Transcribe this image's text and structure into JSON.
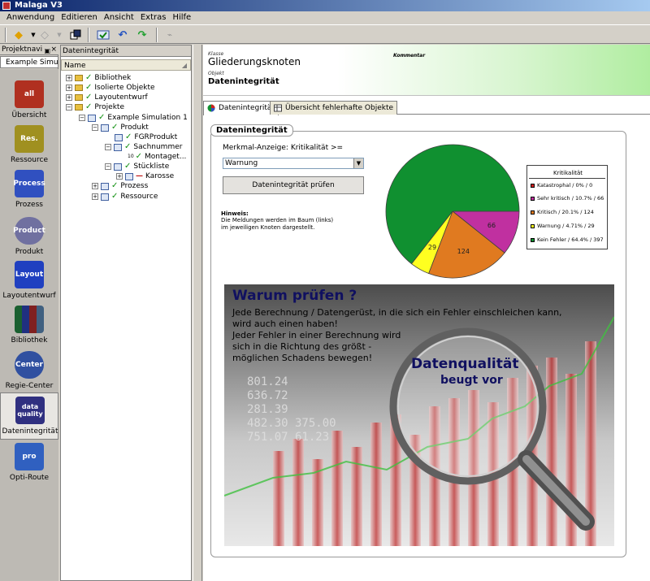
{
  "window": {
    "title": "Malaga V3"
  },
  "menu": [
    "Anwendung",
    "Editieren",
    "Ansicht",
    "Extras",
    "Hilfe"
  ],
  "nav": {
    "header": "Projektnavi",
    "tab": "Example Simu...",
    "items": [
      {
        "label": "Übersicht",
        "icon_text": "all",
        "color": "#b03020"
      },
      {
        "label": "Ressource",
        "icon_text": "Res.",
        "color": "#a09020"
      },
      {
        "label": "Prozess",
        "icon_text": "Process",
        "color": "#3050c0"
      },
      {
        "label": "Produkt",
        "icon_text": "Product",
        "color": "#7070a0"
      },
      {
        "label": "Layoutentwurf",
        "icon_text": "Layout",
        "color": "#2040c0"
      },
      {
        "label": "Bibliothek",
        "icon_text": "",
        "color": "#406080"
      },
      {
        "label": "Regie-Center",
        "icon_text": "Center",
        "color": "#3050a0"
      },
      {
        "label": "Datenintegrität",
        "icon_text": "data quality",
        "color": "#303080"
      },
      {
        "label": "Opti-Route",
        "icon_text": "pro",
        "color": "#3060c0"
      }
    ]
  },
  "tree": {
    "header": "Datenintegrität",
    "column": "Name",
    "rows": [
      {
        "label": "Bibliothek"
      },
      {
        "label": "Isolierte Objekte"
      },
      {
        "label": "Layoutentwurf"
      },
      {
        "label": "Projekte"
      },
      {
        "label": "Example Simulation 1"
      },
      {
        "label": "Produkt"
      },
      {
        "label": "FGRProdukt"
      },
      {
        "label": "Sachnummer"
      },
      {
        "label": "Montaget..."
      },
      {
        "label": "Stückliste"
      },
      {
        "label": "Karosse"
      },
      {
        "label": "Prozess"
      },
      {
        "label": "Ressource"
      }
    ],
    "montage_badge": "10"
  },
  "header": {
    "klasse_label": "Klasse",
    "title": "Gliederungsknoten",
    "objekt_label": "Objekt",
    "subtitle": "Datenintegrität",
    "kommentar_label": "Kommentar"
  },
  "tabs": [
    {
      "label": "Datenintegrität",
      "active": true
    },
    {
      "label": "Übersicht fehlerhafte Objekte",
      "active": false
    }
  ],
  "panel": {
    "title": "Datenintegrität",
    "merkmal_label": "Merkmal-Anzeige:",
    "kritikalitaet_label": "Kritikalität >=",
    "select_value": "Warnung",
    "check_button": "Datenintegrität prüfen",
    "hinweis_title": "Hinweis:",
    "hinweis_line1": "Die Meldungen werden im Baum (links)",
    "hinweis_line2": "im jeweiligen Knoten dargestellt."
  },
  "chart_data": {
    "type": "pie",
    "title": "Kritikalität",
    "series": [
      {
        "name": "Katastrophal / 0% / 0",
        "value": 0,
        "color": "#d02020"
      },
      {
        "name": "Sehr kritisch / 10.7% / 66",
        "value": 66,
        "color": "#c030a0"
      },
      {
        "name": "Kritisch / 20.1% / 124",
        "value": 124,
        "color": "#e07a20"
      },
      {
        "name": "Warnung / 4.71% / 29",
        "value": 29,
        "color": "#ffff20"
      },
      {
        "name": "Kein Fehler / 64.4% / 397",
        "value": 397,
        "color": "#109030"
      }
    ],
    "slice_labels": [
      "66",
      "124",
      "29"
    ]
  },
  "banner": {
    "heading": "Warum prüfen ?",
    "line1": "Jede Berechnung / Datengerüst, in die sich ein Fehler einschleichen kann,",
    "line2": "wird auch einen haben!",
    "line3": "Jeder Fehler in einer Berechnung wird",
    "line4": "sich in die Richtung des größt -",
    "line5": "möglichen Schadens bewegen!",
    "quality": "Datenqualität",
    "prevents": "beugt vor",
    "numbers": [
      "801.24",
      "636.72",
      "281.39",
      "482.30   375.00",
      "751.07   61.23"
    ]
  }
}
